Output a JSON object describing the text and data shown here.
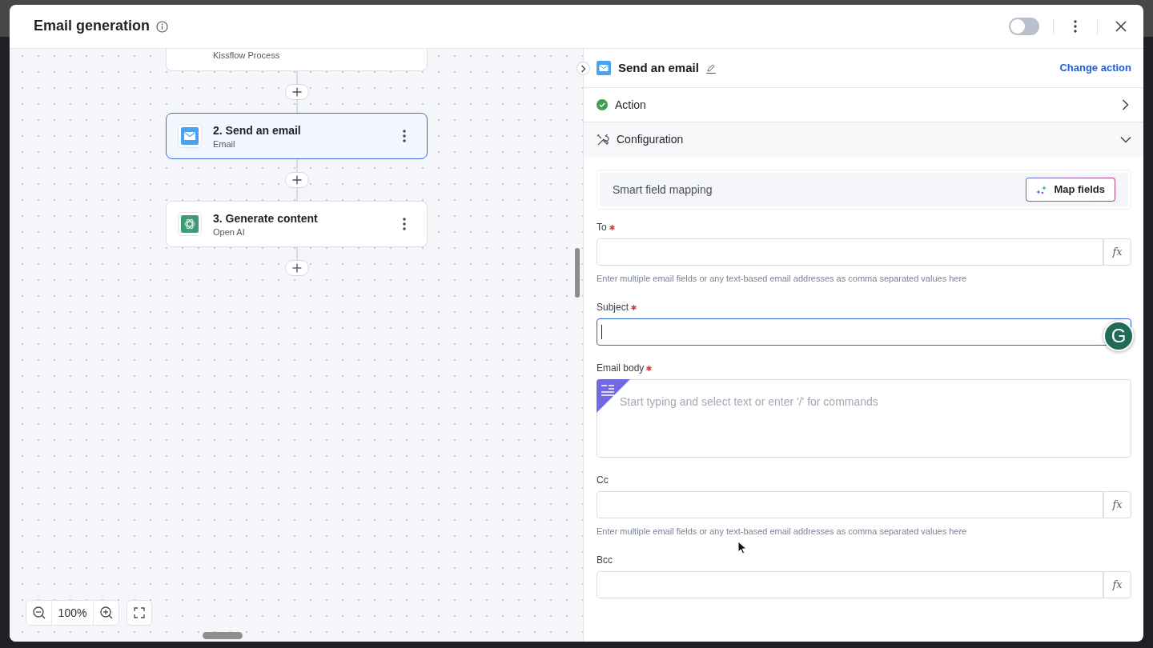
{
  "header": {
    "title": "Email generation",
    "active": false
  },
  "canvas": {
    "nodes": [
      {
        "kind": "partial",
        "subtitle": "Kissflow Process",
        "selected": false
      },
      {
        "kind": "email",
        "title": "2. Send an email",
        "subtitle": "Email",
        "selected": true
      },
      {
        "kind": "openai",
        "title": "3. Generate content",
        "subtitle": "Open AI",
        "selected": false
      }
    ],
    "zoom": "100%"
  },
  "panel": {
    "title": "Send an email",
    "link": "Change action",
    "sections": [
      {
        "kind": "status",
        "title": "Action",
        "done": true,
        "expanded": false
      },
      {
        "kind": "tools",
        "title": "Configuration",
        "expanded": true
      }
    ],
    "smart_mapping": {
      "label": "Smart field mapping",
      "button": "Map fields"
    },
    "fields": [
      {
        "kind": "input",
        "label": "To",
        "required": true,
        "focused": false,
        "addon": "fx",
        "hint": "Enter multiple email fields or any text-based email addresses as comma separated values here"
      },
      {
        "kind": "input",
        "label": "Subject",
        "required": true,
        "focused": true
      },
      {
        "kind": "editor",
        "label": "Email body",
        "required": true,
        "focused": false,
        "placeholder": "Start typing and select text or enter '/' for commands"
      },
      {
        "kind": "input",
        "label": "Cc",
        "required": false,
        "focused": false,
        "addon": "fx",
        "hint": "Enter multiple email fields or any text-based email addresses as comma separated values here"
      },
      {
        "kind": "input",
        "label": "Bcc",
        "required": false,
        "focused": false,
        "addon": "fx"
      }
    ],
    "badge": {
      "letter": "G"
    }
  }
}
